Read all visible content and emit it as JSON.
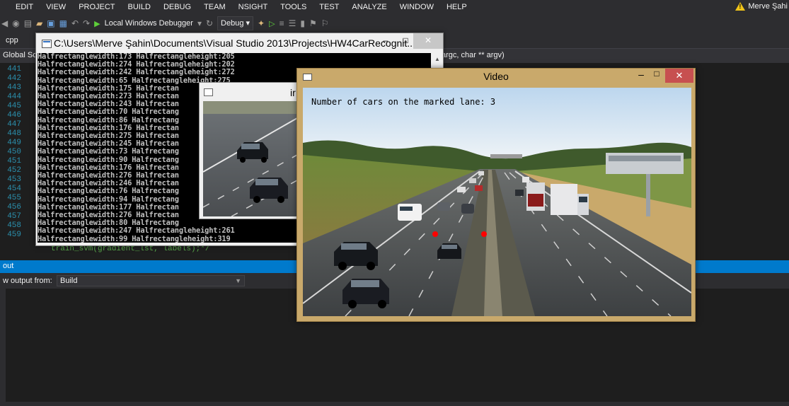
{
  "menu": [
    "EDIT",
    "VIEW",
    "PROJECT",
    "BUILD",
    "DEBUG",
    "TEAM",
    "NSIGHT",
    "TOOLS",
    "TEST",
    "ANALYZE",
    "WINDOW",
    "HELP"
  ],
  "user": {
    "name": "Merve Şahi"
  },
  "toolbar": {
    "debugger_label": "Local Windows Debugger",
    "config": "Debug"
  },
  "editor": {
    "file_tab": "cpp",
    "scope": "Global Sc",
    "function_sig": "argc, char ** argv)",
    "line_numbers": [
      "441",
      "442",
      "443",
      "444",
      "445",
      "446",
      "447",
      "448",
      "449",
      "450",
      "451",
      "452",
      "453",
      "454",
      "455",
      "456",
      "457",
      "458",
      "459"
    ],
    "last_code_line": "train_svm(gradient_lst, labels);*/"
  },
  "output": {
    "header": "out",
    "show_label": "w output from:",
    "source": "Build"
  },
  "console": {
    "title": "C:\\Users\\Merve Şahin\\Documents\\Visual Studio 2013\\Projects\\HW4CarRecognit...",
    "lines": [
      "Halfrectanglewidth:173 Halfrectangleheight:205",
      "Halfrectanglewidth:274 Halfrectangleheight:202",
      "Halfrectanglewidth:242 Halfrectangleheight:272",
      "Halfrectanglewidth:65 Halfrectangleheight:275",
      "Halfrectanglewidth:175 Halfrectan",
      "Halfrectanglewidth:273 Halfrectan",
      "Halfrectanglewidth:243 Halfrectan",
      "Halfrectanglewidth:70 Halfrectang",
      "Halfrectanglewidth:86 Halfrectang",
      "Halfrectanglewidth:176 Halfrectan",
      "Halfrectanglewidth:275 Halfrectan",
      "Halfrectanglewidth:245 Halfrectan",
      "Halfrectanglewidth:73 Halfrectang",
      "Halfrectanglewidth:90 Halfrectang",
      "Halfrectanglewidth:176 Halfrectan",
      "Halfrectanglewidth:276 Halfrectan",
      "Halfrectanglewidth:246 Halfrectan",
      "Halfrectanglewidth:76 Halfrectang",
      "Halfrectanglewidth:94 Halfrectang",
      "Halfrectanglewidth:177 Halfrectan",
      "Halfrectanglewidth:276 Halfrectan",
      "Halfrectanglewidth:80 Halfrectang",
      "Halfrectanglewidth:247 Halfrectangleheight:261",
      "Halfrectanglewidth:99 Halfrectangleheight:319"
    ]
  },
  "image_window": {
    "title": "ir"
  },
  "video": {
    "title": "Video",
    "caption": "Number of cars on the marked lane: 3",
    "minimize": "–",
    "maximize": "□",
    "close": "✕"
  },
  "colors": {
    "accent": "#007acc",
    "marker": "#ff0000",
    "video_frame": "#c9a96b",
    "close_red": "#c75050"
  }
}
